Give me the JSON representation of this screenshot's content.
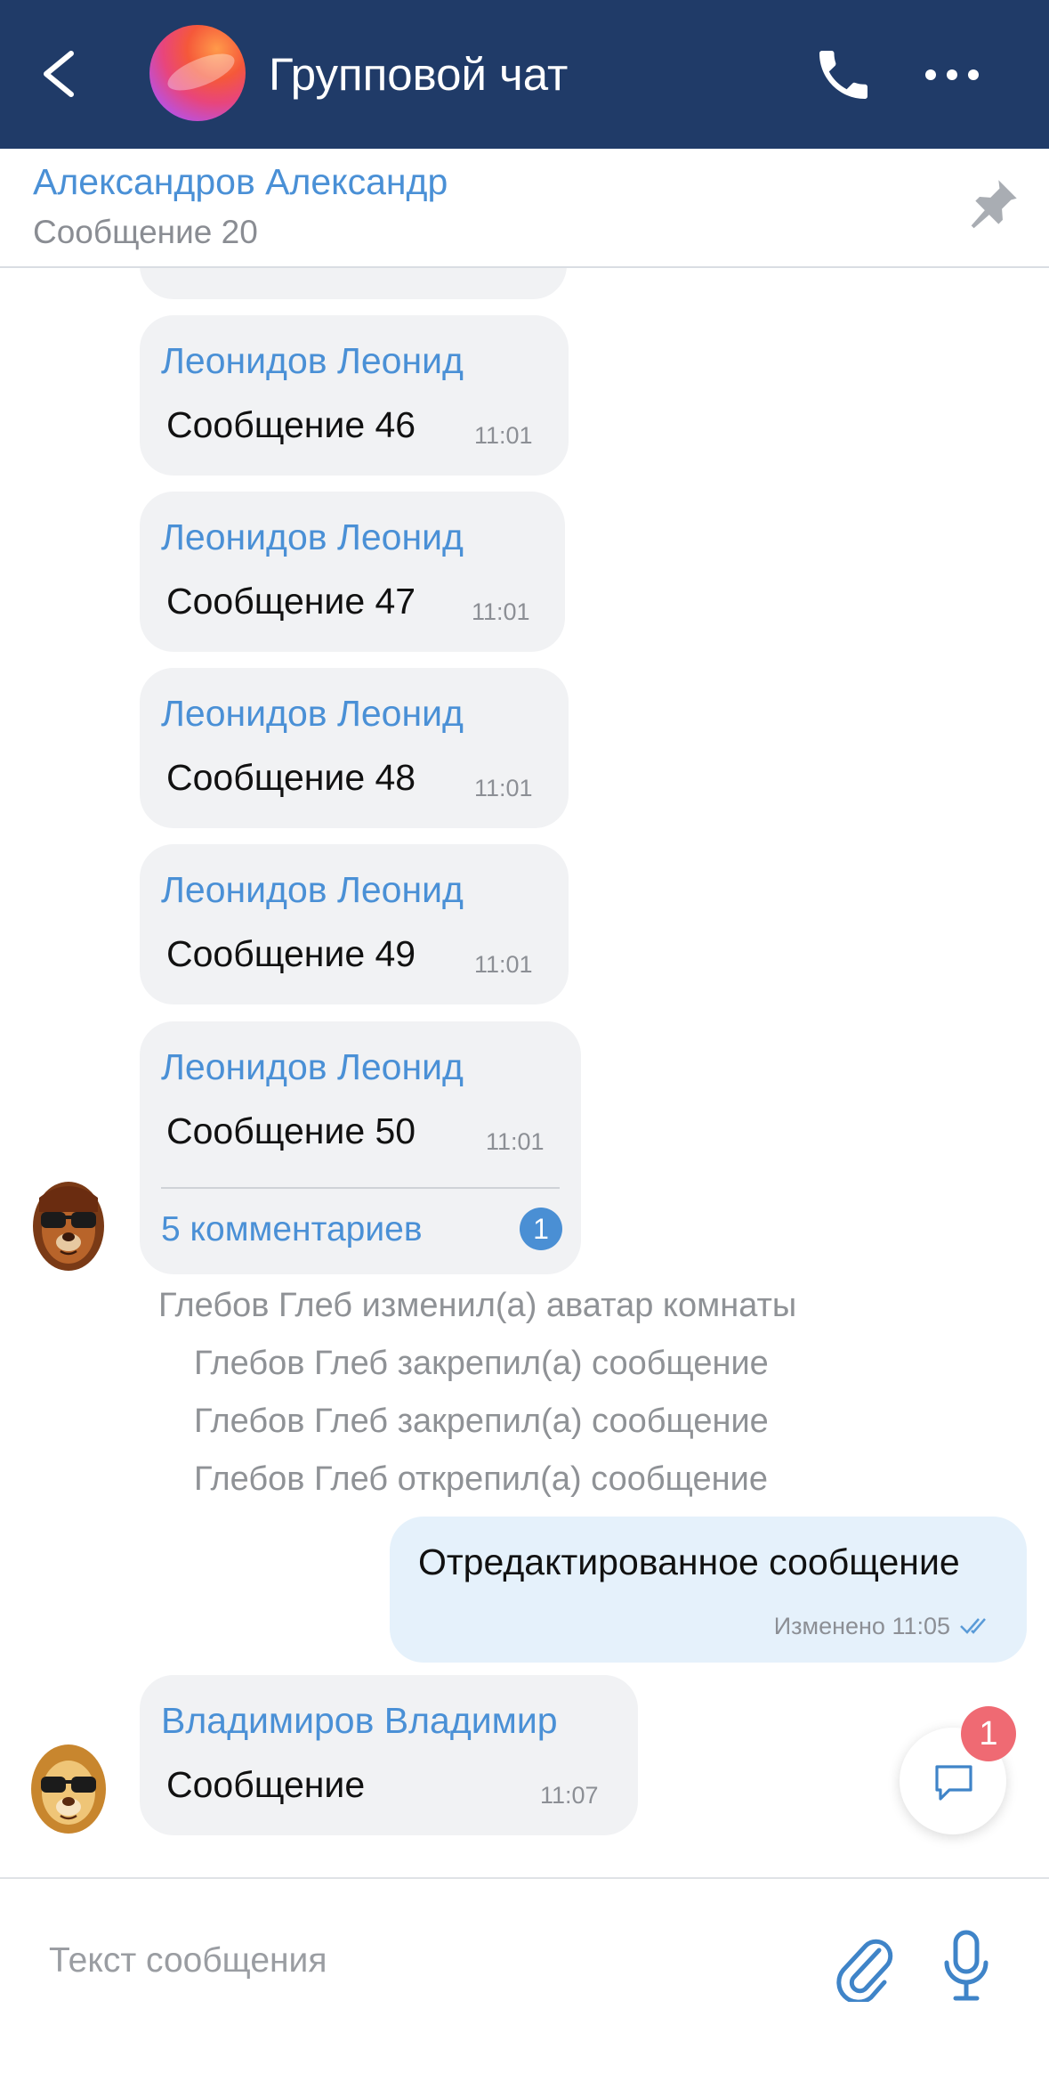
{
  "header": {
    "title": "Групповой чат"
  },
  "pinned": {
    "author": "Александров Александр",
    "text": "Сообщение 20"
  },
  "messages": [
    {
      "author": "Леонидов Леонид",
      "text": "Сообщение 46",
      "time": "11:01"
    },
    {
      "author": "Леонидов Леонид",
      "text": "Сообщение 47",
      "time": "11:01"
    },
    {
      "author": "Леонидов Леонид",
      "text": "Сообщение 48",
      "time": "11:01"
    },
    {
      "author": "Леонидов Леонид",
      "text": "Сообщение 49",
      "time": "11:01"
    },
    {
      "author": "Леонидов Леонид",
      "text": "Сообщение 50",
      "time": "11:01",
      "comments": "5 комментариев",
      "comments_badge": "1"
    }
  ],
  "system_messages": [
    "Глебов Глеб изменил(а) аватар комнаты",
    "Глебов Глеб закрепил(а) сообщение",
    "Глебов Глеб закрепил(а) сообщение",
    "Глебов Глеб открепил(а) сообщение"
  ],
  "own_message": {
    "text": "Отредактированное сообщение",
    "meta": "Изменено 11:05"
  },
  "last_message": {
    "author": "Владимиров Владимир",
    "text": "Сообщение",
    "time": "11:07"
  },
  "fab": {
    "badge": "1"
  },
  "composer": {
    "placeholder": "Текст сообщения"
  },
  "colors": {
    "header_bg": "#203b68",
    "accent": "#4a90d6",
    "bubble_bg": "#f1f2f4",
    "own_bubble_bg": "#e5f1fb",
    "badge_red": "#ef6a73"
  },
  "icons": [
    "back-icon",
    "phone-icon",
    "more-icon",
    "pin-icon",
    "chat-icon",
    "paperclip-icon",
    "microphone-icon",
    "double-check-icon"
  ]
}
